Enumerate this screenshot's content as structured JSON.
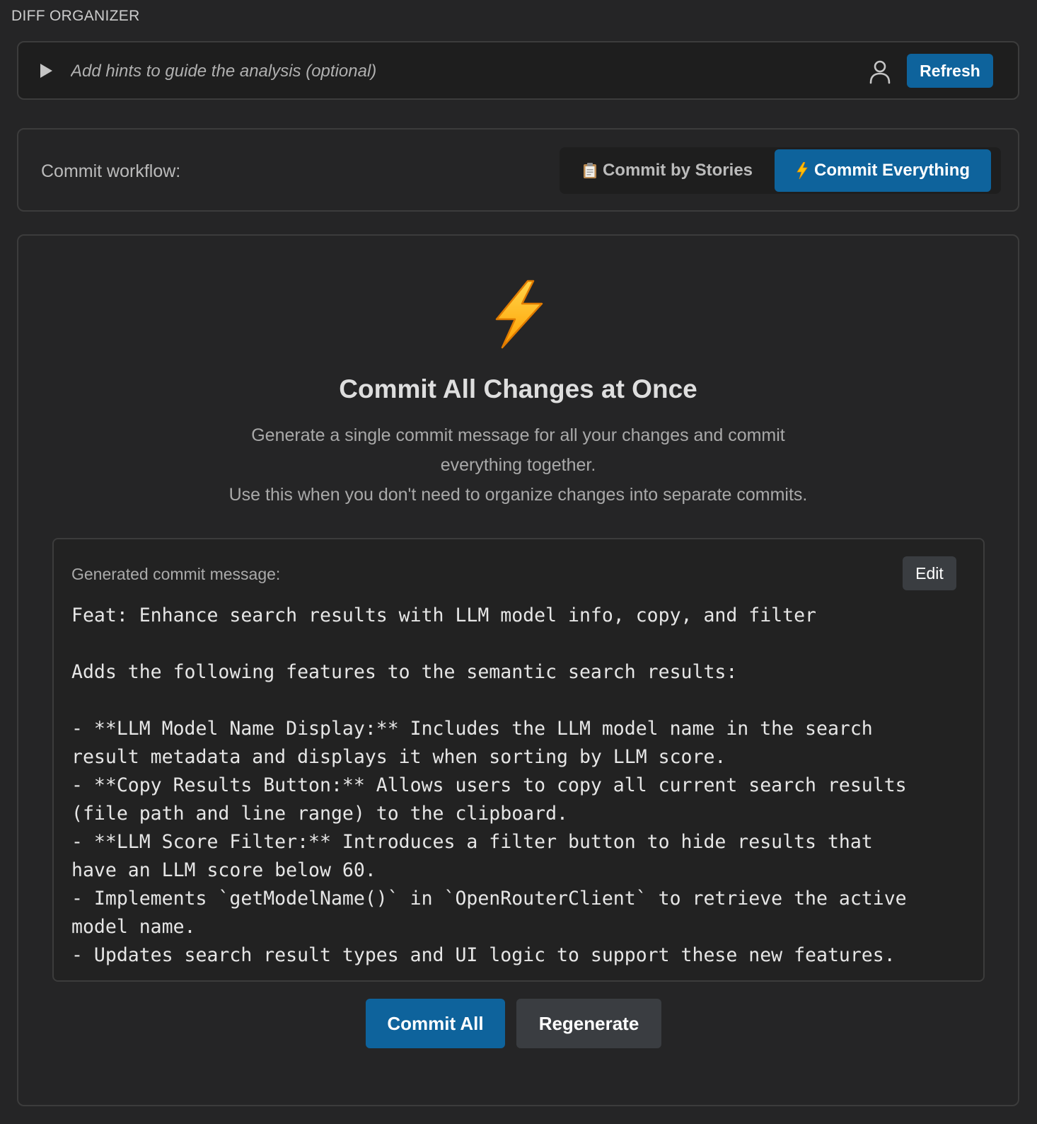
{
  "header": {
    "title": "DIFF ORGANIZER"
  },
  "hints": {
    "placeholder": "Add hints to guide the analysis (optional)",
    "value": "",
    "refresh_label": "Refresh"
  },
  "workflow": {
    "label": "Commit workflow:",
    "options": [
      {
        "label": "Commit by Stories",
        "icon": "clipboard-icon",
        "selected": false
      },
      {
        "label": "Commit Everything",
        "icon": "lightning-icon",
        "selected": true
      }
    ]
  },
  "main": {
    "heading": "Commit All Changes at Once",
    "description_lines": [
      "Generate a single commit message for all your changes and commit",
      "everything together.",
      "Use this when you don't need to organize changes into separate commits."
    ],
    "message_label": "Generated commit message:",
    "edit_label": "Edit",
    "commit_message": "Feat: Enhance search results with LLM model info, copy, and filter\n\nAdds the following features to the semantic search results:\n\n- **LLM Model Name Display:** Includes the LLM model name in the search\nresult metadata and displays it when sorting by LLM score.\n- **Copy Results Button:** Allows users to copy all current search results\n(file path and line range) to the clipboard.\n- **LLM Score Filter:** Introduces a filter button to hide results that\nhave an LLM score below 60.\n- Implements `getModelName()` in `OpenRouterClient` to retrieve the active\nmodel name.\n- Updates search result types and UI logic to support these new features.",
    "commit_all_label": "Commit All",
    "regenerate_label": "Regenerate"
  },
  "colors": {
    "background": "#252526",
    "accent": "#0e639c",
    "secondary_button": "#3a3d41",
    "border": "#3c3c3c",
    "bolt": "#ffb300"
  }
}
